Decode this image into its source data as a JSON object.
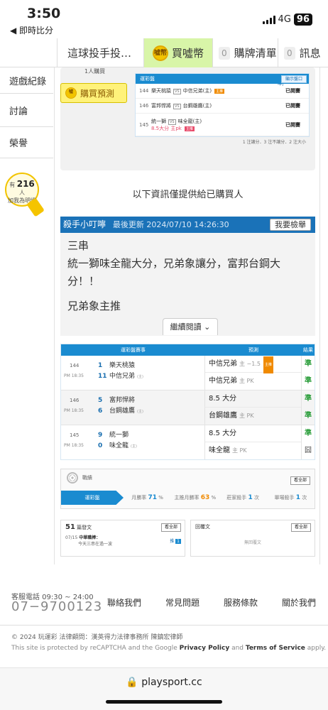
{
  "status": {
    "time": "3:50",
    "back_label": "◀ 即時比分",
    "network": "4G",
    "battery": "96"
  },
  "tabs": [
    {
      "label": "這球投手投…"
    },
    {
      "label": "買噓幣",
      "coin": "噓幣",
      "active": true
    },
    {
      "label": "購牌清單",
      "count": "0"
    },
    {
      "label": "訊息",
      "count": "0"
    }
  ],
  "sidebar": {
    "items": [
      "遊戲紀錄",
      "討論",
      "榮譽"
    ]
  },
  "bulb": {
    "prefix": "有",
    "count": "216",
    "unit": "人",
    "caption": "加我為明燈"
  },
  "predict": {
    "buyers": "1人購買",
    "buy_button": "購買預測",
    "mini_header": "運彩盤",
    "mini_link": "[所有殺手小叮嚀]",
    "mini_show": "顯示盤口",
    "rows": [
      {
        "id": "144",
        "home": "樂天桃猿",
        "away": "中信兄弟(主)",
        "badge": "主推",
        "result": "已開賽"
      },
      {
        "id": "146",
        "home": "富邦悍將",
        "away": "台鋼雄鷹(主)",
        "result": "已開賽"
      },
      {
        "id": "145",
        "home": "統一獅",
        "away": "味全龍(主)",
        "pick": "8.5大分 主pk",
        "badge": "主推",
        "result": "已開賽"
      }
    ],
    "footnote": "1 注讓分．3 注不讓分．2 注大小"
  },
  "notice": "以下資訊僅提供給已購買人",
  "killer": {
    "title": "殺手小叮嚀",
    "updated": "最後更新 2024/07/10 14:26:30",
    "report": "我要檢舉",
    "lines": [
      "三串",
      "統一獅味全龍大分，兄弟象讓分，富邦台鋼大",
      "分！！",
      "兄弟象主推"
    ],
    "read_more": "繼續閱讀 ⌄"
  },
  "table": {
    "headers": [
      "運彩盤賽事",
      "預測",
      "結果"
    ],
    "groups": [
      {
        "id": "144",
        "time": "PM 18:35",
        "t1no": "1",
        "t1": "樂天桃猿",
        "t2no": "11",
        "t2": "中信兄弟",
        "t2tag": "(主)",
        "preds": [
          {
            "main": "中信兄弟",
            "sub": "主 −1.5",
            "badge": "主推"
          },
          {
            "main": "中信兄弟",
            "sub": "主 PK"
          }
        ],
        "results": [
          "準",
          "準"
        ]
      },
      {
        "id": "146",
        "time": "PM 18:35",
        "t1no": "5",
        "t1": "富邦悍將",
        "t2no": "6",
        "t2": "台鋼雄鷹",
        "t2tag": "(主)",
        "preds": [
          {
            "main": "8.5 大分",
            "sub": ""
          },
          {
            "main": "台鋼雄鷹",
            "sub": "主 PK"
          }
        ],
        "results": [
          "準",
          "準"
        ]
      },
      {
        "id": "145",
        "time": "PM 18:35",
        "t1no": "9",
        "t1": "統一獅",
        "t2no": "0",
        "t2": "味全龍",
        "t2tag": "(主)",
        "preds": [
          {
            "main": "8.5 大分",
            "sub": ""
          },
          {
            "main": "味全龍",
            "sub": "主 PK"
          }
        ],
        "results": [
          "準",
          "囧"
        ]
      }
    ]
  },
  "stats": {
    "title": "戰績",
    "see_all": "看全部",
    "label": "運彩盤",
    "month_win": "月勝率",
    "month_win_val": "71",
    "month_win_unit": "%",
    "home_win": "主推月勝率",
    "home_win_val": "63",
    "home_win_unit": "%",
    "banker": "莊家殺手",
    "banker_val": "1",
    "banker_unit": "次",
    "single": "單場殺手",
    "single_val": "1",
    "single_unit": "次"
  },
  "fans": {
    "count": "51",
    "label": "篇發文",
    "see_all": "看全部",
    "date": "07/15",
    "post_title": "中華職棒：",
    "post_body": "今天三串在過一波",
    "page_label": "推",
    "page": "1"
  },
  "replies": {
    "title": "回覆文",
    "see_all": "看全部",
    "empty": "無回覆文"
  },
  "footer": {
    "hotline_label": "客服電話 09:30 ~ 24:00",
    "hotline": "07−9700123",
    "links": [
      "聯絡我們",
      "常見問題",
      "服務條款",
      "關於我們"
    ],
    "copyright": "© 2024 玩運彩 法律顧問：漢英得力法律事務所 陳鎮宏律師",
    "recaptcha_pre": "This site is protected by reCAPTCHA and the Google ",
    "privacy": "Privacy Policy",
    "and": " and ",
    "terms": "Terms of Service",
    "apply": " apply."
  },
  "browser": {
    "url": "🔒 playsport.cc"
  }
}
